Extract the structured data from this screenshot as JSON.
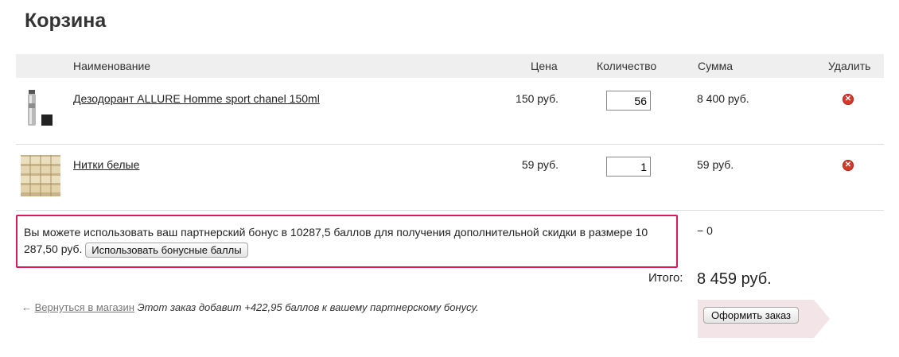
{
  "page": {
    "title": "Корзина"
  },
  "table": {
    "headers": {
      "name": "Наименование",
      "price": "Цена",
      "qty": "Количество",
      "sum": "Сумма",
      "delete": "Удалить"
    },
    "rows": [
      {
        "name": "Дезодорант ALLURE Homme sport chanel 150ml",
        "price": "150 руб.",
        "qty": "56",
        "sum": "8 400 руб.",
        "delete_icon": "remove-icon"
      },
      {
        "name": "Нитки белые",
        "price": "59 руб.",
        "qty": "1",
        "sum": "59 руб.",
        "delete_icon": "remove-icon"
      }
    ]
  },
  "bonus": {
    "text": "Вы можете использовать ваш партнерский бонус в 10287,5 баллов для получения дополнительной скидки в размере 10 287,50 руб.",
    "button": "Использовать бонусные баллы",
    "discount": "− 0",
    "highlight_color": "#d8195e"
  },
  "total": {
    "label": "Итого:",
    "value": "8 459 руб."
  },
  "footer": {
    "back_arrow": "←",
    "back_link": "Вернуться в магазин",
    "note": "Этот заказ добавит +422,95 баллов к вашему партнерскому бонусу.",
    "order_button": "Оформить заказ"
  },
  "colors": {
    "header_bg": "#efefef",
    "delete": "#d23a2a",
    "arrow": "#f3e4e8"
  }
}
